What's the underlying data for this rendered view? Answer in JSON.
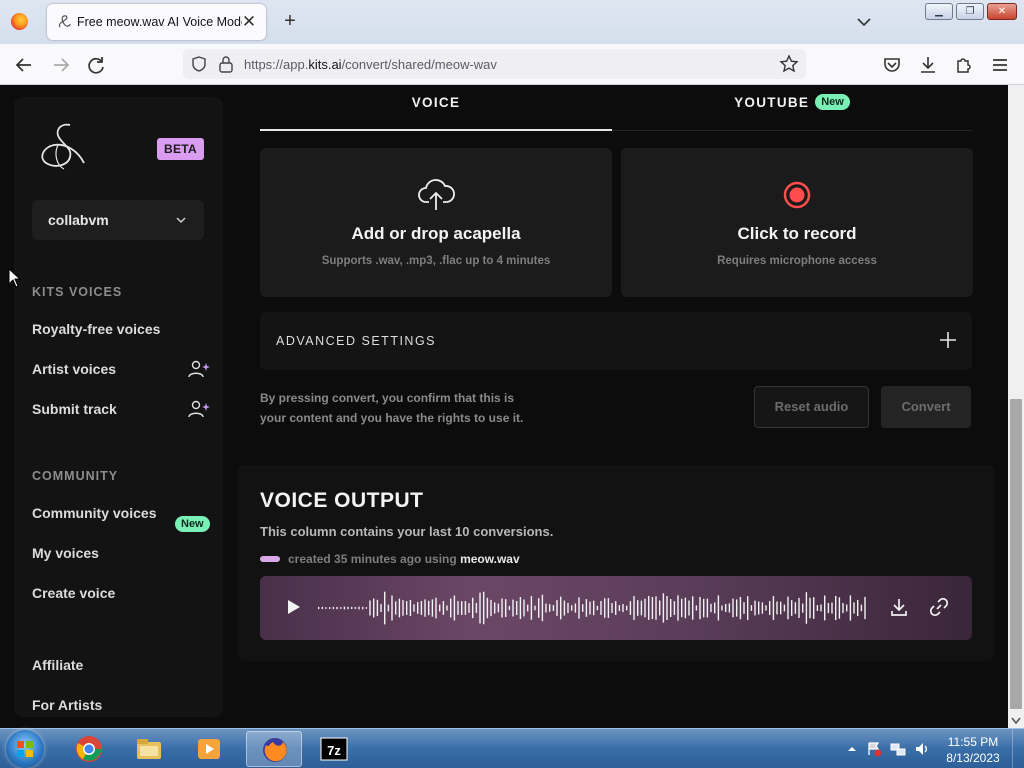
{
  "browser": {
    "tab_title": "Free meow.wav AI Voice Model",
    "url_prefix": "https://app.",
    "url_domain": "kits.ai",
    "url_path": "/convert/shared/meow-wav"
  },
  "sidebar": {
    "beta": "BETA",
    "workspace": "collabvm",
    "section_kits": "KITS VOICES",
    "section_community": "COMMUNITY",
    "items": {
      "royalty_free": "Royalty-free voices",
      "artist_voices": "Artist voices",
      "submit_track": "Submit track",
      "community_voices": "Community voices",
      "my_voices": "My voices",
      "create_voice": "Create voice",
      "affiliate": "Affiliate",
      "for_artists": "For Artists"
    },
    "new_badge": "New"
  },
  "tabs": {
    "voice": "VOICE",
    "youtube": "YOUTUBE",
    "youtube_badge": "New"
  },
  "upload": {
    "title": "Add or drop acapella",
    "subtitle": "Supports .wav, .mp3, .flac up to 4 minutes"
  },
  "record": {
    "title": "Click to record",
    "subtitle": "Requires microphone access"
  },
  "advanced": {
    "label": "ADVANCED SETTINGS"
  },
  "consent": {
    "line1": "By pressing convert, you confirm that this is",
    "line2": "your content and you have the rights to use it."
  },
  "buttons": {
    "reset": "Reset audio",
    "convert": "Convert"
  },
  "output": {
    "title": "VOICE OUTPUT",
    "subtitle": "This column contains your last 10 conversions.",
    "meta_prefix": "created 35 minutes ago using",
    "meta_model": "meow.wav"
  },
  "taskbar": {
    "time": "11:55 PM",
    "date": "8/13/2023"
  },
  "colors": {
    "accent_beta": "#d99cf0",
    "new_badge": "#7af0b6",
    "record_red": "#ff4d4d",
    "page_bg": "#0c0c0c"
  }
}
